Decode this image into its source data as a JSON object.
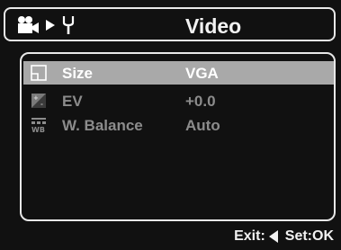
{
  "header": {
    "title": "Video",
    "icons": [
      "video-camera-icon",
      "arrow-right-icon",
      "wrench-icon"
    ]
  },
  "menu": {
    "items": [
      {
        "label": "Size",
        "value": "VGA",
        "icon": "image-size-icon",
        "selected": true
      },
      {
        "label": "EV",
        "value": "+0.0",
        "icon": "exposure-icon",
        "selected": false
      },
      {
        "label": "W. Balance",
        "value": "Auto",
        "icon": "white-balance-icon",
        "selected": false
      }
    ]
  },
  "footer": {
    "exit_label": "Exit:",
    "set_label": "Set:OK"
  },
  "colors": {
    "background": "#111111",
    "selected_row": "#a9a9a9",
    "text": "#f2f2f2",
    "dim_text": "#8c8c8c"
  }
}
